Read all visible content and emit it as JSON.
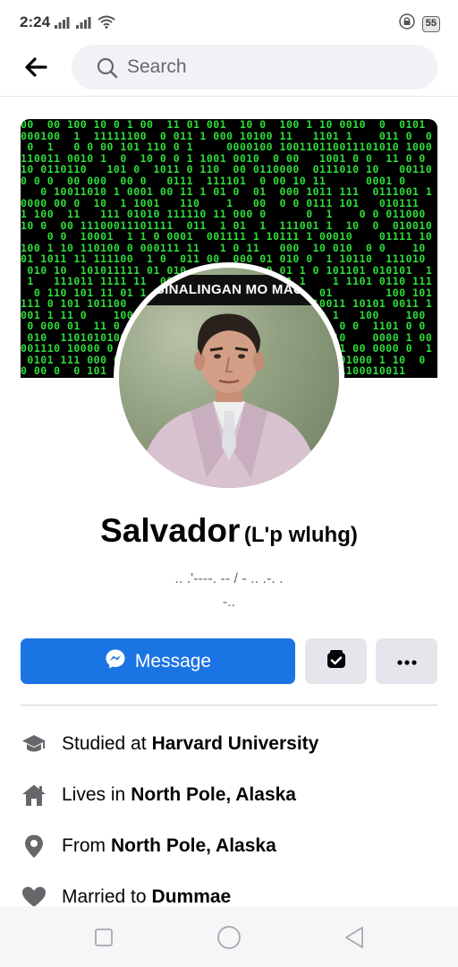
{
  "status_bar": {
    "time": "2:24",
    "battery": "55",
    "icons": [
      "signal-icon",
      "signal-icon",
      "wifi-icon",
      "lock-icon",
      "battery-icon"
    ]
  },
  "search": {
    "placeholder": "Search"
  },
  "cover": {
    "overlay_text": "GINALINGAN MO MAG"
  },
  "profile": {
    "name": "Salvador",
    "alt_name": "(L'p wluhg)",
    "bio_line1": ".. .'----. -- / - .. .-. .",
    "bio_line2": "-.."
  },
  "actions": {
    "message_label": "Message",
    "pages_icon": "wallet-check-icon",
    "more_icon": "more-dots-icon"
  },
  "details": [
    {
      "icon": "graduation-cap-icon",
      "prefix": "Studied at",
      "value": "Harvard University"
    },
    {
      "icon": "home-icon",
      "prefix": "Lives in",
      "value": "North Pole, Alaska"
    },
    {
      "icon": "location-pin-icon",
      "prefix": "From",
      "value": "North Pole, Alaska"
    },
    {
      "icon": "heart-icon",
      "prefix": "Married to",
      "value": "Dummae"
    }
  ],
  "colors": {
    "accent": "#1b74e4",
    "matrix_green": "#2fdc3a",
    "secondary_text": "#65676b"
  }
}
